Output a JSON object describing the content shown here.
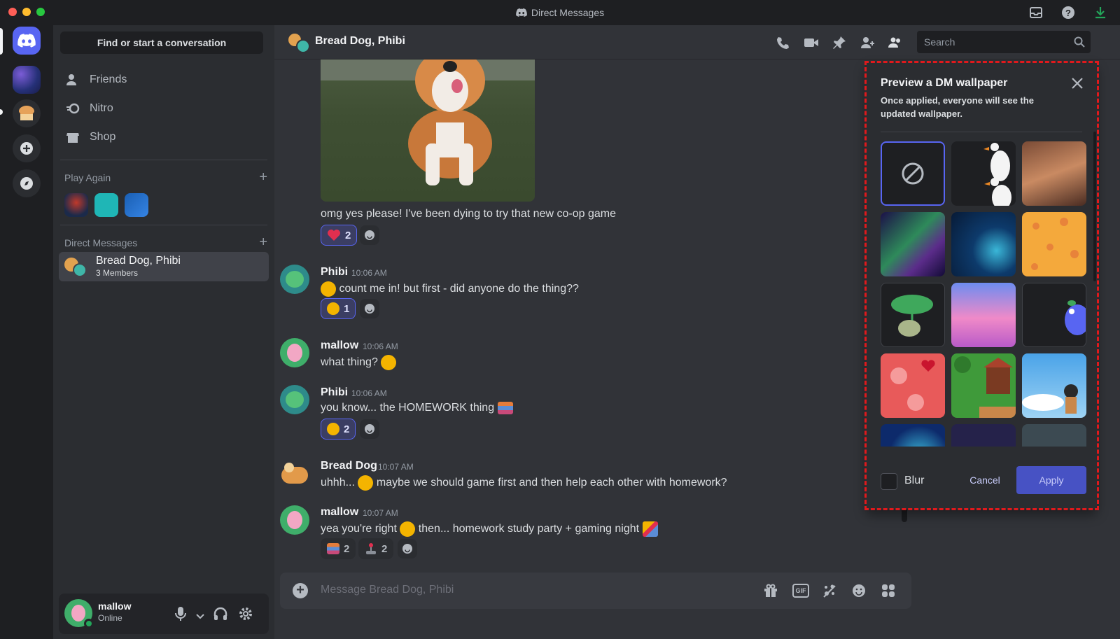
{
  "window": {
    "title": "Direct Messages"
  },
  "sidebar": {
    "find_button": "Find or start a conversation",
    "nav": [
      {
        "label": "Friends"
      },
      {
        "label": "Nitro"
      },
      {
        "label": "Shop"
      }
    ],
    "play_again_header": "Play Again",
    "play_again_add": "+",
    "dm_header": "Direct Messages",
    "dm_add": "+",
    "dm_selected": {
      "name": "Bread Dog, Phibi",
      "subtitle": "3 Members"
    }
  },
  "user_panel": {
    "username": "mallow",
    "status": "Online"
  },
  "chat": {
    "header_title": "Bread Dog, Phibi",
    "search_placeholder": "Search",
    "messages": [
      {
        "text": "omg yes please! I've been dying to try that new co-op game",
        "reactions": [
          {
            "count": "2"
          }
        ]
      },
      {
        "author": "Phibi",
        "time": "10:06 AM",
        "text": "count me in! but first - did anyone do the thing??",
        "reactions": [
          {
            "count": "1"
          }
        ]
      },
      {
        "author": "mallow",
        "time": "10:06 AM",
        "text": "what thing?"
      },
      {
        "author": "Phibi",
        "time": "10:06 AM",
        "text": "you know... the HOMEWORK thing",
        "reactions": [
          {
            "count": "2"
          }
        ]
      },
      {
        "author": "Bread Dog",
        "time": "10:07 AM",
        "text_a": "uhhh...",
        "text_b": "maybe we should game first and then help each other with homework?"
      },
      {
        "author": "mallow",
        "time": "10:07 AM",
        "text_a": "yea you're right",
        "text_b": "then... homework study party + gaming night",
        "reactions": [
          {
            "count": "2"
          },
          {
            "count": "2"
          }
        ]
      }
    ],
    "composer_placeholder": "Message Bread Dog, Phibi",
    "composer_gif": "GIF"
  },
  "wallpaper_popout": {
    "title": "Preview a DM wallpaper",
    "description": "Once applied, everyone will see the updated wallpaper.",
    "blur_label": "Blur",
    "cancel_label": "Cancel",
    "apply_label": "Apply",
    "options": [
      "none",
      "geese",
      "attic-room",
      "aurora",
      "underwater-glow",
      "orange-pattern",
      "leaf-frog",
      "pink-city",
      "purple-creature",
      "pink-hearts",
      "pixel-village",
      "sky-girl",
      "blue-glow",
      "night-sky",
      "clouds-partial"
    ],
    "selected": "none"
  },
  "colors": {
    "accent": "#5865f2",
    "highlight_border": "#e0191c",
    "bg_main": "#313338",
    "bg_sidebar": "#2b2d31"
  }
}
